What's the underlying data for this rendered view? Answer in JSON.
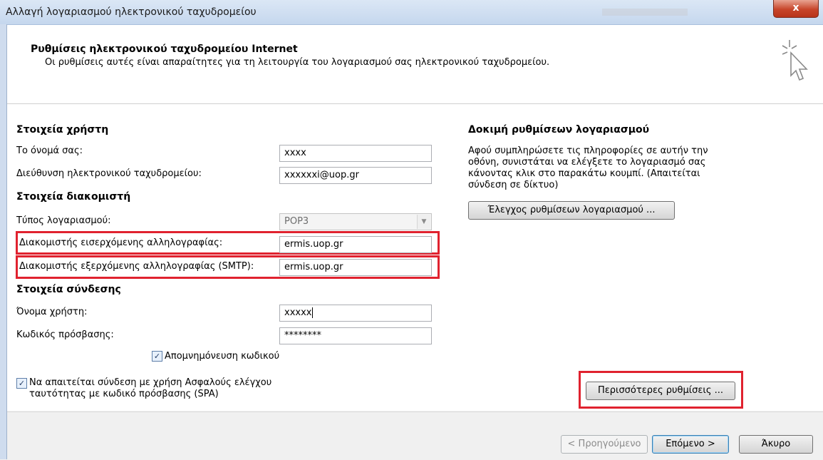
{
  "window": {
    "title": "Αλλαγή λογαριασμού ηλεκτρονικού ταχυδρομείου",
    "close_glyph": "x"
  },
  "header": {
    "title": "Ρυθμίσεις ηλεκτρονικού ταχυδρομείου Internet",
    "subtitle": "Οι ρυθμίσεις αυτές είναι απαραίτητες για τη λειτουργία του λογαριασμού σας ηλεκτρονικού ταχυδρομείου."
  },
  "user_info": {
    "section": "Στοιχεία χρήστη",
    "name_label": "Το όνομά σας:",
    "name_value": "xxxx",
    "email_label": "Διεύθυνση ηλεκτρονικού ταχυδρομείου:",
    "email_value": "xxxxxxi@uop.gr"
  },
  "server_info": {
    "section": "Στοιχεία διακομιστή",
    "account_type_label": "Τύπος λογαριασμού:",
    "account_type_value": "POP3",
    "incoming_label": "Διακομιστής εισερχόμενης αλληλογραφίας:",
    "incoming_value": "ermis.uop.gr",
    "outgoing_label": "Διακομιστής εξερχόμενης αλληλογραφίας (SMTP):",
    "outgoing_value": "ermis.uop.gr"
  },
  "login_info": {
    "section": "Στοιχεία σύνδεσης",
    "username_label": "Όνομα χρήστη:",
    "username_value": "xxxxx",
    "password_label": "Κωδικός πρόσβασης:",
    "password_value": "********",
    "remember_label": "Απομνημόνευση κωδικού",
    "remember_checked": true,
    "spa_label_line1": "Να απαιτείται σύνδεση με χρήση Ασφαλούς ελέγχου",
    "spa_label_line2": "ταυτότητας με κωδικό πρόσβασης (SPA)",
    "spa_checked": true
  },
  "test": {
    "section": "Δοκιμή ρυθμίσεων λογαριασμού",
    "desc_line1": "Αφού συμπληρώσετε τις πληροφορίες σε αυτήν την",
    "desc_line2": "οθόνη, συνιστάται να ελέγξετε το λογαριασμό σας",
    "desc_line3": "κάνοντας κλικ στο παρακάτω κουμπί. (Απαιτείται",
    "desc_line4": "σύνδεση σε δίκτυο)",
    "test_button": "Έλεγχος ρυθμίσεων λογαριασμού ..."
  },
  "more_settings_button": "Περισσότερες ρυθμίσεις ...",
  "footer": {
    "back": "< Προηγούμενο",
    "next": "Επόμενο >",
    "cancel": "Άκυρο"
  },
  "checkmark_glyph": "✓",
  "dropdown_glyph": "▼",
  "colors": {
    "highlight_red": "#e0222f",
    "accent_blue": "#3c7fb1"
  }
}
